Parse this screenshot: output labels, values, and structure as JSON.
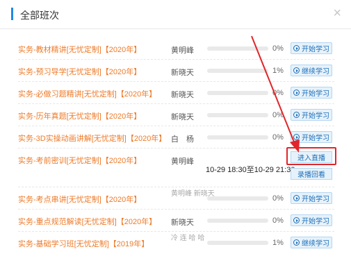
{
  "dialog": {
    "title": "全部班次",
    "close_symbol": "×"
  },
  "colors": {
    "accent": "#1e88e5",
    "course_link": "#ee7a28",
    "annotation": "#e0262a",
    "button_text": "#1e6fb8"
  },
  "rows": [
    {
      "course": "实务-教材精讲[无忧定制]【2020年】",
      "teacher": "黄明峰",
      "progress": "0%",
      "action": "开始学习"
    },
    {
      "course": "实务-预习导学[无忧定制]【2020年】",
      "teacher": "新晓天",
      "progress": "1%",
      "action": "继续学习"
    },
    {
      "course": "实务-必做习题精讲[无忧定制]【2020年】",
      "teacher": "新晓天",
      "progress": "0%",
      "action": "开始学习"
    },
    {
      "course": "实务-历年真题[无忧定制]【2020年】",
      "teacher": "新晓天",
      "progress": "0%",
      "action": "开始学习"
    },
    {
      "course": "实务-3D实操动画讲解[无忧定制]【2020年】",
      "teacher": "白　杨",
      "progress": "0%",
      "action": "开始学习"
    },
    {
      "course": "实务-考前密训[无忧定制]【2020年】",
      "teacher": "黄明峰",
      "time": "10-29 18:30至10-29 21:30",
      "action": "进入直播",
      "action2": "录播回看"
    },
    {
      "course": "实务-考点串讲[无忧定制]【2020年】",
      "teacher": "黄明峰 新晓天",
      "progress": "0%",
      "action": "开始学习"
    },
    {
      "course": "实务-重点规范解读[无忧定制]【2020年】",
      "teacher": "新晓天",
      "progress": "0%",
      "action": "开始学习"
    },
    {
      "course": "实务-基础学习班[无忧定制]【2019年】",
      "teacher": "冷 连 哈 哈",
      "progress": "1%",
      "action": "继续学习"
    }
  ]
}
